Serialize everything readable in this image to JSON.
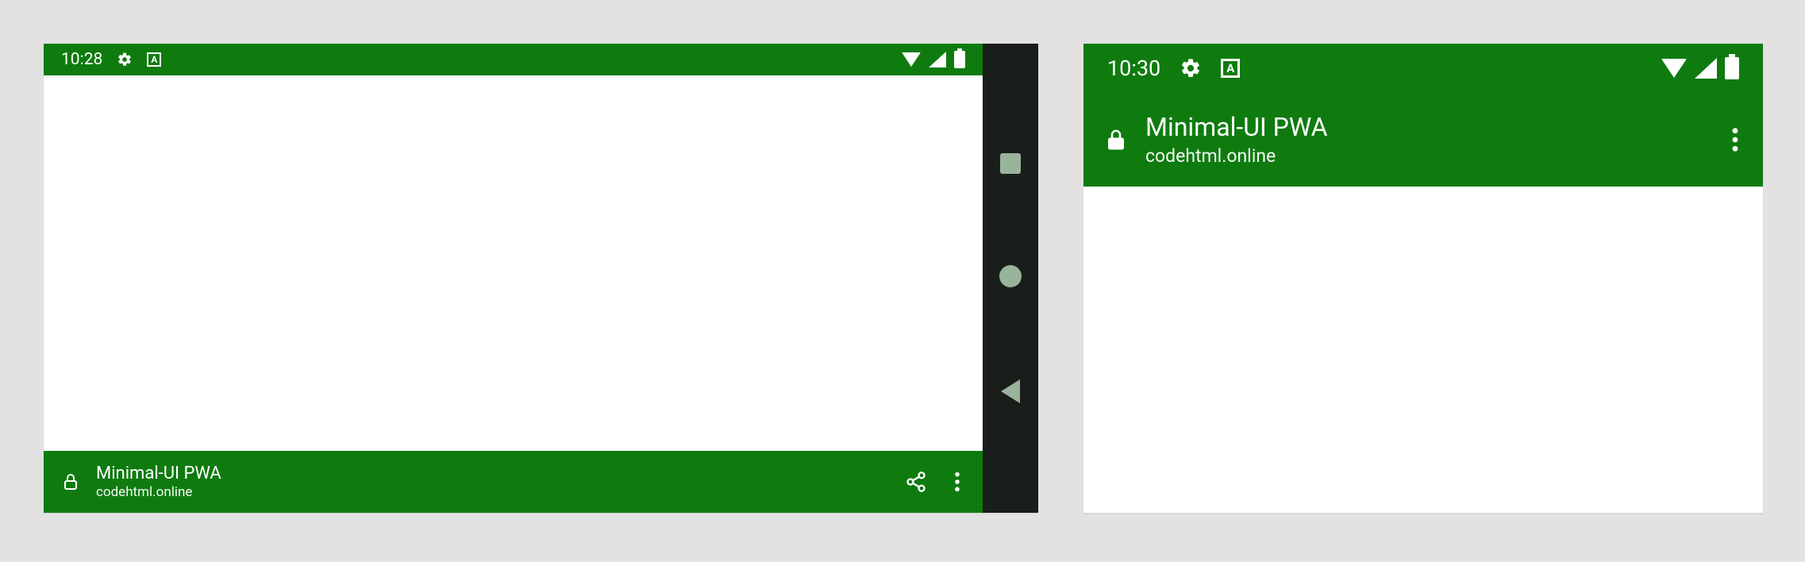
{
  "colors": {
    "accent": "#0f7b0f",
    "navbar_bg": "#1a1e1a",
    "nav_icon": "#9ab49c",
    "page_bg": "#e2e2e2"
  },
  "left_device": {
    "status": {
      "time": "10:28",
      "icons": [
        "gear-icon",
        "language-icon",
        "wifi-icon",
        "signal-icon",
        "battery-icon"
      ]
    },
    "appbar": {
      "title": "Minimal-UI PWA",
      "subtitle": "codehtml.online"
    },
    "nav_buttons": [
      "overview",
      "home",
      "back"
    ]
  },
  "right_device": {
    "status": {
      "time": "10:30",
      "icons": [
        "gear-icon",
        "language-icon",
        "wifi-icon",
        "signal-icon",
        "battery-icon"
      ]
    },
    "appbar": {
      "title": "Minimal-UI PWA",
      "subtitle": "codehtml.online"
    }
  }
}
